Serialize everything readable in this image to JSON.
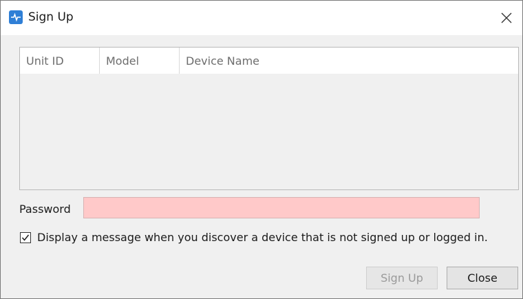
{
  "window": {
    "title": "Sign Up"
  },
  "table": {
    "columns": [
      "Unit ID",
      "Model",
      "Device Name"
    ],
    "rows": []
  },
  "password": {
    "label": "Password",
    "value": "",
    "placeholder": ""
  },
  "option": {
    "checked": true,
    "label": "Display a message when you discover a device that is not signed up or logged in."
  },
  "buttons": {
    "signup_label": "Sign Up",
    "signup_enabled": false,
    "close_label": "Close"
  },
  "colors": {
    "accent": "#2f7fd6",
    "password_invalid_bg": "#ffc9c9"
  }
}
